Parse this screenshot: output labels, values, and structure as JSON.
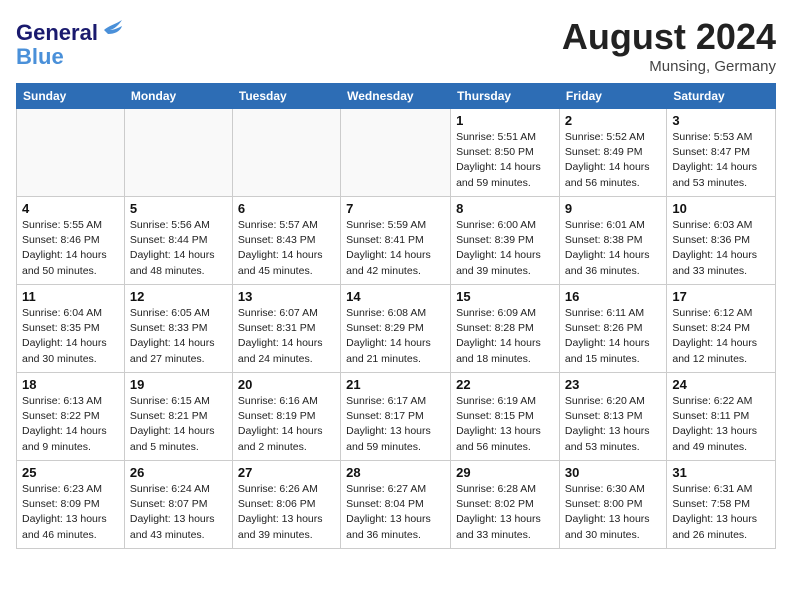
{
  "header": {
    "logo_line1": "General",
    "logo_line2": "Blue",
    "month_year": "August 2024",
    "location": "Munsing, Germany"
  },
  "weekdays": [
    "Sunday",
    "Monday",
    "Tuesday",
    "Wednesday",
    "Thursday",
    "Friday",
    "Saturday"
  ],
  "weeks": [
    [
      {
        "day": "",
        "info": ""
      },
      {
        "day": "",
        "info": ""
      },
      {
        "day": "",
        "info": ""
      },
      {
        "day": "",
        "info": ""
      },
      {
        "day": "1",
        "info": "Sunrise: 5:51 AM\nSunset: 8:50 PM\nDaylight: 14 hours\nand 59 minutes."
      },
      {
        "day": "2",
        "info": "Sunrise: 5:52 AM\nSunset: 8:49 PM\nDaylight: 14 hours\nand 56 minutes."
      },
      {
        "day": "3",
        "info": "Sunrise: 5:53 AM\nSunset: 8:47 PM\nDaylight: 14 hours\nand 53 minutes."
      }
    ],
    [
      {
        "day": "4",
        "info": "Sunrise: 5:55 AM\nSunset: 8:46 PM\nDaylight: 14 hours\nand 50 minutes."
      },
      {
        "day": "5",
        "info": "Sunrise: 5:56 AM\nSunset: 8:44 PM\nDaylight: 14 hours\nand 48 minutes."
      },
      {
        "day": "6",
        "info": "Sunrise: 5:57 AM\nSunset: 8:43 PM\nDaylight: 14 hours\nand 45 minutes."
      },
      {
        "day": "7",
        "info": "Sunrise: 5:59 AM\nSunset: 8:41 PM\nDaylight: 14 hours\nand 42 minutes."
      },
      {
        "day": "8",
        "info": "Sunrise: 6:00 AM\nSunset: 8:39 PM\nDaylight: 14 hours\nand 39 minutes."
      },
      {
        "day": "9",
        "info": "Sunrise: 6:01 AM\nSunset: 8:38 PM\nDaylight: 14 hours\nand 36 minutes."
      },
      {
        "day": "10",
        "info": "Sunrise: 6:03 AM\nSunset: 8:36 PM\nDaylight: 14 hours\nand 33 minutes."
      }
    ],
    [
      {
        "day": "11",
        "info": "Sunrise: 6:04 AM\nSunset: 8:35 PM\nDaylight: 14 hours\nand 30 minutes."
      },
      {
        "day": "12",
        "info": "Sunrise: 6:05 AM\nSunset: 8:33 PM\nDaylight: 14 hours\nand 27 minutes."
      },
      {
        "day": "13",
        "info": "Sunrise: 6:07 AM\nSunset: 8:31 PM\nDaylight: 14 hours\nand 24 minutes."
      },
      {
        "day": "14",
        "info": "Sunrise: 6:08 AM\nSunset: 8:29 PM\nDaylight: 14 hours\nand 21 minutes."
      },
      {
        "day": "15",
        "info": "Sunrise: 6:09 AM\nSunset: 8:28 PM\nDaylight: 14 hours\nand 18 minutes."
      },
      {
        "day": "16",
        "info": "Sunrise: 6:11 AM\nSunset: 8:26 PM\nDaylight: 14 hours\nand 15 minutes."
      },
      {
        "day": "17",
        "info": "Sunrise: 6:12 AM\nSunset: 8:24 PM\nDaylight: 14 hours\nand 12 minutes."
      }
    ],
    [
      {
        "day": "18",
        "info": "Sunrise: 6:13 AM\nSunset: 8:22 PM\nDaylight: 14 hours\nand 9 minutes."
      },
      {
        "day": "19",
        "info": "Sunrise: 6:15 AM\nSunset: 8:21 PM\nDaylight: 14 hours\nand 5 minutes."
      },
      {
        "day": "20",
        "info": "Sunrise: 6:16 AM\nSunset: 8:19 PM\nDaylight: 14 hours\nand 2 minutes."
      },
      {
        "day": "21",
        "info": "Sunrise: 6:17 AM\nSunset: 8:17 PM\nDaylight: 13 hours\nand 59 minutes."
      },
      {
        "day": "22",
        "info": "Sunrise: 6:19 AM\nSunset: 8:15 PM\nDaylight: 13 hours\nand 56 minutes."
      },
      {
        "day": "23",
        "info": "Sunrise: 6:20 AM\nSunset: 8:13 PM\nDaylight: 13 hours\nand 53 minutes."
      },
      {
        "day": "24",
        "info": "Sunrise: 6:22 AM\nSunset: 8:11 PM\nDaylight: 13 hours\nand 49 minutes."
      }
    ],
    [
      {
        "day": "25",
        "info": "Sunrise: 6:23 AM\nSunset: 8:09 PM\nDaylight: 13 hours\nand 46 minutes."
      },
      {
        "day": "26",
        "info": "Sunrise: 6:24 AM\nSunset: 8:07 PM\nDaylight: 13 hours\nand 43 minutes."
      },
      {
        "day": "27",
        "info": "Sunrise: 6:26 AM\nSunset: 8:06 PM\nDaylight: 13 hours\nand 39 minutes."
      },
      {
        "day": "28",
        "info": "Sunrise: 6:27 AM\nSunset: 8:04 PM\nDaylight: 13 hours\nand 36 minutes."
      },
      {
        "day": "29",
        "info": "Sunrise: 6:28 AM\nSunset: 8:02 PM\nDaylight: 13 hours\nand 33 minutes."
      },
      {
        "day": "30",
        "info": "Sunrise: 6:30 AM\nSunset: 8:00 PM\nDaylight: 13 hours\nand 30 minutes."
      },
      {
        "day": "31",
        "info": "Sunrise: 6:31 AM\nSunset: 7:58 PM\nDaylight: 13 hours\nand 26 minutes."
      }
    ]
  ]
}
